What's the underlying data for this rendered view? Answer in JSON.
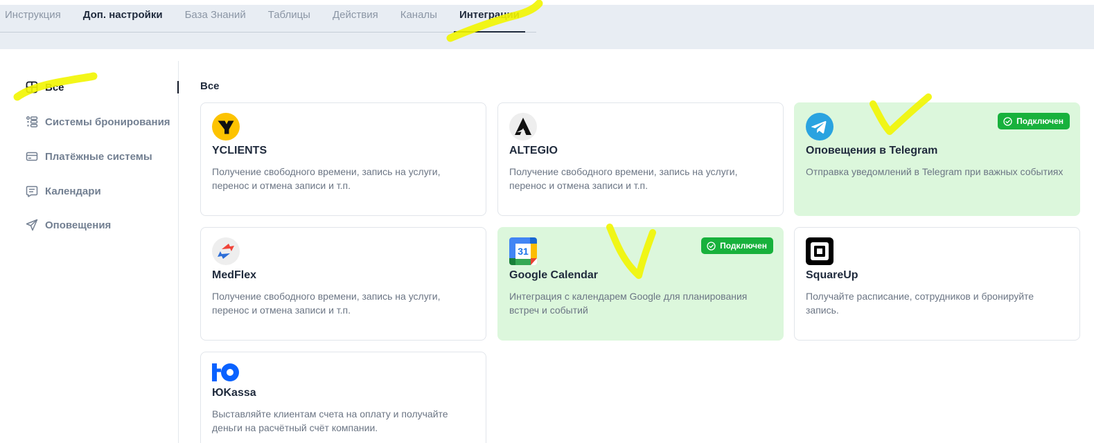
{
  "tabs": [
    {
      "label": "Инструкция"
    },
    {
      "label": "Доп. настройки"
    },
    {
      "label": "База Знаний"
    },
    {
      "label": "Таблицы"
    },
    {
      "label": "Действия"
    },
    {
      "label": "Каналы"
    },
    {
      "label": "Интеграции"
    }
  ],
  "sidebar": {
    "items": [
      {
        "label": "Все",
        "icon": "grid-icon"
      },
      {
        "label": "Системы бронирования",
        "icon": "booking-list-icon"
      },
      {
        "label": "Платёжные системы",
        "icon": "card-icon"
      },
      {
        "label": "Календари",
        "icon": "calendar-note-icon"
      },
      {
        "label": "Оповещения",
        "icon": "send-icon"
      }
    ]
  },
  "main": {
    "section_title": "Все",
    "connected_label": "Подключен",
    "cards": [
      {
        "title": "YCLIENTS",
        "description": "Получение свободного времени, запись на услуги, перенос и отмена записи и т.п.",
        "logo": "yclients-logo",
        "connected": false
      },
      {
        "title": "ALTEGIO",
        "description": "Получение свободного времени, запись на услуги, перенос и отмена записи и т.п.",
        "logo": "altegio-logo",
        "connected": false
      },
      {
        "title": "Оповещения в Telegram",
        "description": "Отправка уведомлений в Telegram при важных событиях",
        "logo": "telegram-logo",
        "connected": true
      },
      {
        "title": "MedFlex",
        "description": "Получение свободного времени, запись на услуги, перенос и отмена записи и т.п.",
        "logo": "medflex-logo",
        "connected": false
      },
      {
        "title": "Google Calendar",
        "description": "Интеграция с календарем Google для планирования встреч и событий",
        "logo": "google-calendar-logo",
        "calendar_day": "31",
        "connected": true
      },
      {
        "title": "SquareUp",
        "description": "Получайте расписание, сотрудников и бронируйте запись.",
        "logo": "squareup-logo",
        "connected": false
      },
      {
        "title": "ЮKassa",
        "description": "Выставляйте клиентам счета на оплату и получайте деньги на расчётный счёт компании.",
        "logo": "yookassa-logo",
        "connected": false
      }
    ]
  },
  "colors": {
    "topbar_bg": "#e8edf3",
    "connected_card_bg": "#dcf7dc",
    "badge_bg": "#18b13c",
    "highlight": "#f2f500"
  }
}
